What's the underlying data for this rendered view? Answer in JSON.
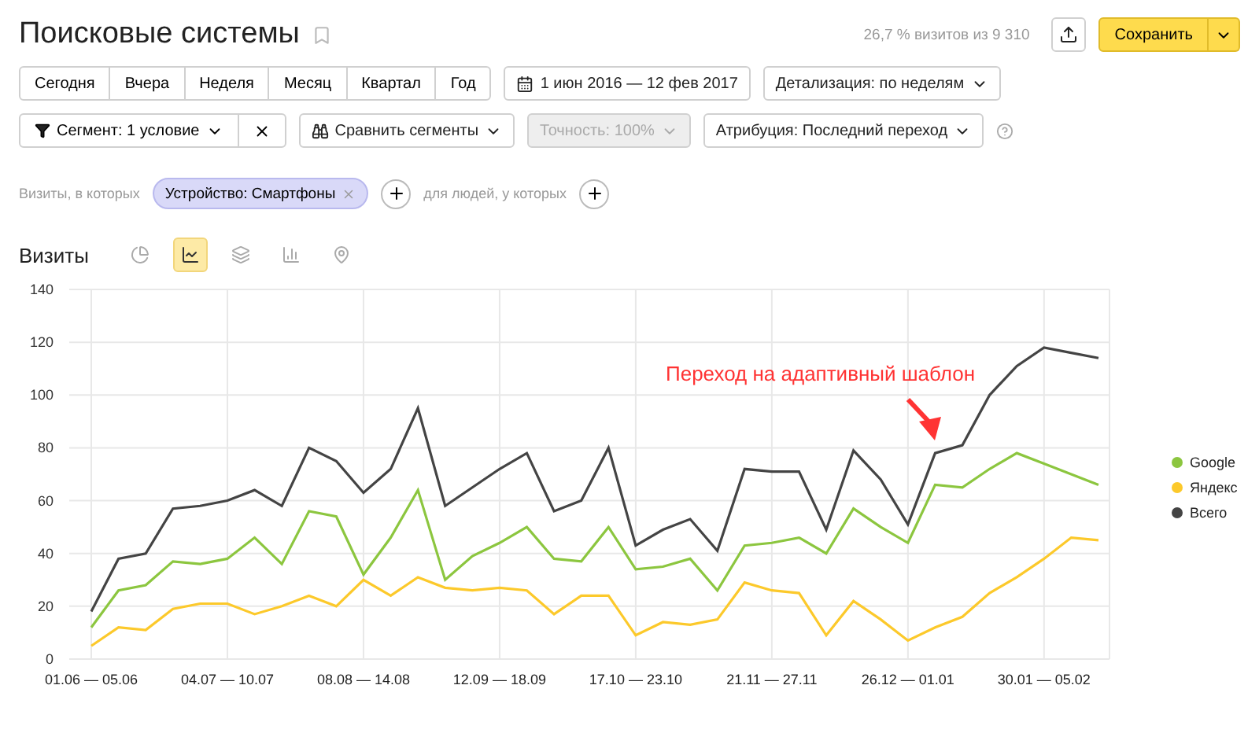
{
  "title": "Поисковые системы",
  "stats": "26,7 % визитов из 9 310",
  "save_button": "Сохранить",
  "periods": [
    "Сегодня",
    "Вчера",
    "Неделя",
    "Месяц",
    "Квартал",
    "Год"
  ],
  "date_range": "1 июн 2016 — 12 фев 2017",
  "detail": "Детализация: по неделям",
  "segment": "Сегмент: 1 условие",
  "compare": "Сравнить сегменты",
  "accuracy": {
    "label": "Точность: 100%",
    "disabled": true
  },
  "attribution": "Атрибуция: Последний переход",
  "filter": {
    "prefix": "Визиты, в которых",
    "chip": "Устройство: Смартфоны",
    "people": "для людей, у которых"
  },
  "section": {
    "title": "Визиты",
    "chart_types": [
      {
        "kind": "pie",
        "selected": false
      },
      {
        "kind": "line",
        "selected": true
      },
      {
        "kind": "area",
        "selected": false
      },
      {
        "kind": "bar",
        "selected": false
      },
      {
        "kind": "map",
        "selected": false
      }
    ]
  },
  "chart_data": {
    "type": "line",
    "grid": true,
    "legend": true,
    "categories": [
      "01.06 — 05.06",
      null,
      null,
      null,
      null,
      "04.07 — 10.07",
      null,
      null,
      null,
      null,
      "08.08 — 14.08",
      null,
      null,
      null,
      null,
      "12.09 — 18.09",
      null,
      null,
      null,
      null,
      "17.10 — 23.10",
      null,
      null,
      null,
      null,
      "21.11 — 27.11",
      null,
      null,
      null,
      null,
      "26.12 — 01.01",
      null,
      null,
      null,
      null,
      "30.01 — 05.02",
      null,
      null
    ],
    "ylim": [
      0,
      140
    ],
    "yticks": [
      0,
      20,
      40,
      60,
      80,
      100,
      120,
      140
    ],
    "series": [
      {
        "name": "Google",
        "color": "#8cc63f",
        "values": [
          12,
          26,
          28,
          37,
          36,
          38,
          46,
          36,
          56,
          54,
          32,
          46,
          64,
          30,
          39,
          44,
          50,
          38,
          37,
          50,
          34,
          35,
          38,
          26,
          43,
          44,
          46,
          40,
          57,
          50,
          44,
          66,
          65,
          72,
          78,
          74,
          70,
          66
        ]
      },
      {
        "name": "Яндекс",
        "color": "#fcc92b",
        "values": [
          5,
          12,
          11,
          19,
          21,
          21,
          17,
          20,
          24,
          20,
          30,
          24,
          31,
          27,
          26,
          27,
          26,
          17,
          24,
          24,
          9,
          14,
          13,
          15,
          29,
          26,
          25,
          9,
          22,
          15,
          7,
          12,
          16,
          25,
          31,
          38,
          46,
          45
        ]
      },
      {
        "name": "Всего",
        "color": "#444444",
        "values": [
          18,
          38,
          40,
          57,
          58,
          60,
          64,
          58,
          80,
          75,
          63,
          72,
          95,
          58,
          65,
          72,
          78,
          56,
          60,
          80,
          43,
          49,
          53,
          41,
          72,
          71,
          71,
          49,
          79,
          68,
          51,
          78,
          81,
          100,
          111,
          118,
          116,
          114
        ]
      }
    ],
    "annotations": [
      "Переход на адаптивный шаблон"
    ]
  }
}
